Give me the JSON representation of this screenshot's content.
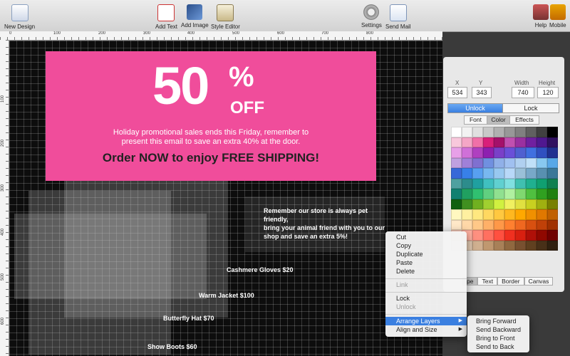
{
  "toolbar": {
    "new_design": "New Design",
    "add_text": "Add Text",
    "add_image": "Add Image",
    "style_editor": "Style Editor",
    "settings": "Settings",
    "send_mail": "Send Mail",
    "help": "Help",
    "mobile": "Mobile"
  },
  "rulers": {
    "top": [
      "0",
      "100",
      "200",
      "300",
      "400",
      "500",
      "600",
      "700",
      "800"
    ],
    "left": [
      "100",
      "200",
      "300",
      "400",
      "500",
      "600"
    ]
  },
  "promo": {
    "big": "50",
    "pct": "%",
    "off": "OFF",
    "line1": "Holiday promotional sales ends this Friday, remember to",
    "line2": "present this email to save an extra 40% at the door.",
    "order": "Order NOW to enjoy FREE SHIPPING!"
  },
  "pet": {
    "line1": "Remember our store is always pet friendly,",
    "line2": "bring your animal friend with you to our",
    "line3": "shop and save an extra 5%!"
  },
  "products": {
    "gloves": "Cashmere Gloves $20",
    "jacket": "Warm Jacket $100",
    "hat": "Butterfly Hat $70",
    "boots": "Show Boots $60"
  },
  "panel": {
    "x_label": "X",
    "y_label": "Y",
    "width_label": "Width",
    "height_label": "Height",
    "x": "534",
    "y": "343",
    "width": "740",
    "height": "120",
    "unlock": "Unlock",
    "lock": "Lock",
    "tab_font": "Font",
    "tab_color": "Color",
    "tab_effects": "Effects",
    "btab_shape": "pe",
    "btab_text": "Text",
    "btab_border": "Border",
    "btab_canvas": "Canvas"
  },
  "palette": [
    "#ffffff",
    "#f2f2f2",
    "#e0e0e0",
    "#c8c8c8",
    "#b0b0b0",
    "#989898",
    "#808080",
    "#606060",
    "#404040",
    "#000000",
    "#f8c8dc",
    "#f4a6c6",
    "#f070a8",
    "#d8207a",
    "#a4106a",
    "#c050b0",
    "#9a30a0",
    "#7020a0",
    "#501890",
    "#301060",
    "#e8a0e8",
    "#d070d8",
    "#b040c0",
    "#8e20b0",
    "#7a40c8",
    "#6a50d8",
    "#5060d0",
    "#4070e0",
    "#3050c0",
    "#203090",
    "#c0a0e0",
    "#a080d8",
    "#8070d0",
    "#7090e0",
    "#90b0e8",
    "#a0c0f0",
    "#b0d0f0",
    "#c0e0f8",
    "#88c8f0",
    "#58a8e8",
    "#3868d8",
    "#3880e8",
    "#58a0f0",
    "#78b8f0",
    "#98c8f0",
    "#b8d8f8",
    "#9ac0d8",
    "#78a8c8",
    "#5890b0",
    "#3a7898",
    "#4fa0a0",
    "#2d8c8c",
    "#20a0a0",
    "#40c0c0",
    "#60d0d0",
    "#80e0e0",
    "#40c0b0",
    "#20b090",
    "#10a070",
    "#108050",
    "#108070",
    "#20a060",
    "#30c070",
    "#60d080",
    "#90e090",
    "#b0f0a0",
    "#80d870",
    "#50c040",
    "#30a020",
    "#208010",
    "#106010",
    "#409020",
    "#70b020",
    "#a0d030",
    "#d0f040",
    "#f0f060",
    "#e0e040",
    "#c8d020",
    "#a0b010",
    "#788000",
    "#fff8c0",
    "#fff0a0",
    "#ffe880",
    "#ffd860",
    "#ffc840",
    "#ffb820",
    "#ffa800",
    "#f09000",
    "#e07800",
    "#c06000",
    "#ffe8c8",
    "#ffd8a8",
    "#ffc888",
    "#ffb068",
    "#ff9848",
    "#ff8030",
    "#f06820",
    "#d85010",
    "#c04008",
    "#a03000",
    "#ffd0c0",
    "#ffb0a0",
    "#ff9080",
    "#ff7060",
    "#ff5040",
    "#f03020",
    "#d82010",
    "#b01008",
    "#900800",
    "#700000",
    "#f0e0d0",
    "#e0c8b0",
    "#d0b090",
    "#c09870",
    "#a88058",
    "#906840",
    "#785030",
    "#604020",
    "#483018",
    "#302010"
  ],
  "context_menu": {
    "cut": "Cut",
    "copy": "Copy",
    "duplicate": "Duplicate",
    "paste": "Paste",
    "delete": "Delete",
    "link": "Link",
    "lock": "Lock",
    "unlock": "Unlock",
    "arrange_layers": "Arrange Layers",
    "align_and_size": "Align and Size"
  },
  "submenu": {
    "bring_forward": "Bring Forward",
    "send_backward": "Send Backward",
    "bring_to_front": "Bring to Front",
    "send_to_back": "Send to Back"
  }
}
